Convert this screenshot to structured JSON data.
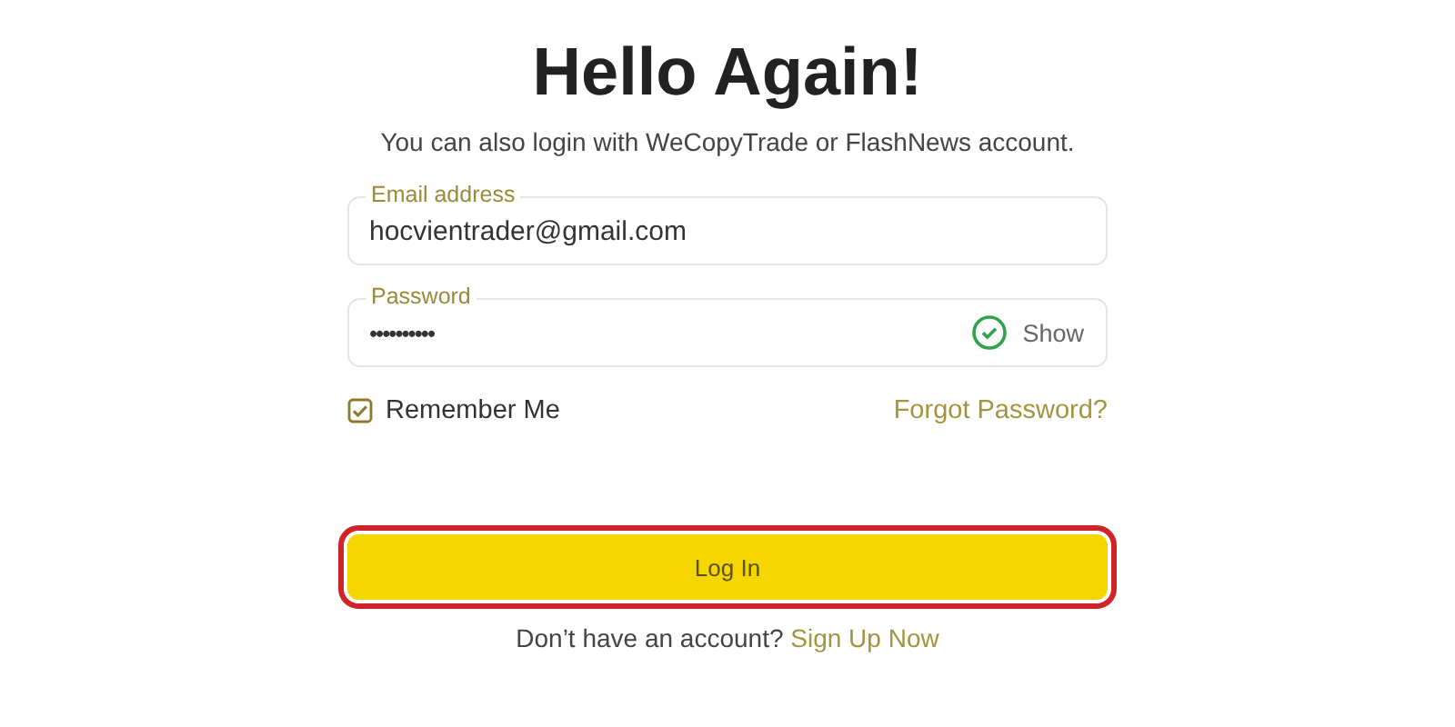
{
  "title": "Hello Again!",
  "subtitle": "You can also login with WeCopyTrade or FlashNews account.",
  "fields": [
    {
      "label": "Email address",
      "value": "hocvientrader@gmail.com",
      "kind": "email"
    },
    {
      "label": "Password",
      "value": "••••••••••",
      "kind": "password",
      "toggle": "Show"
    }
  ],
  "remember": {
    "label": "Remember Me",
    "checked": true
  },
  "forgot": "Forgot Password?",
  "login_button": {
    "label": "Log In",
    "highlighted": true
  },
  "signup": {
    "prompt": "Don’t have an account?",
    "link": "Sign Up Now"
  }
}
